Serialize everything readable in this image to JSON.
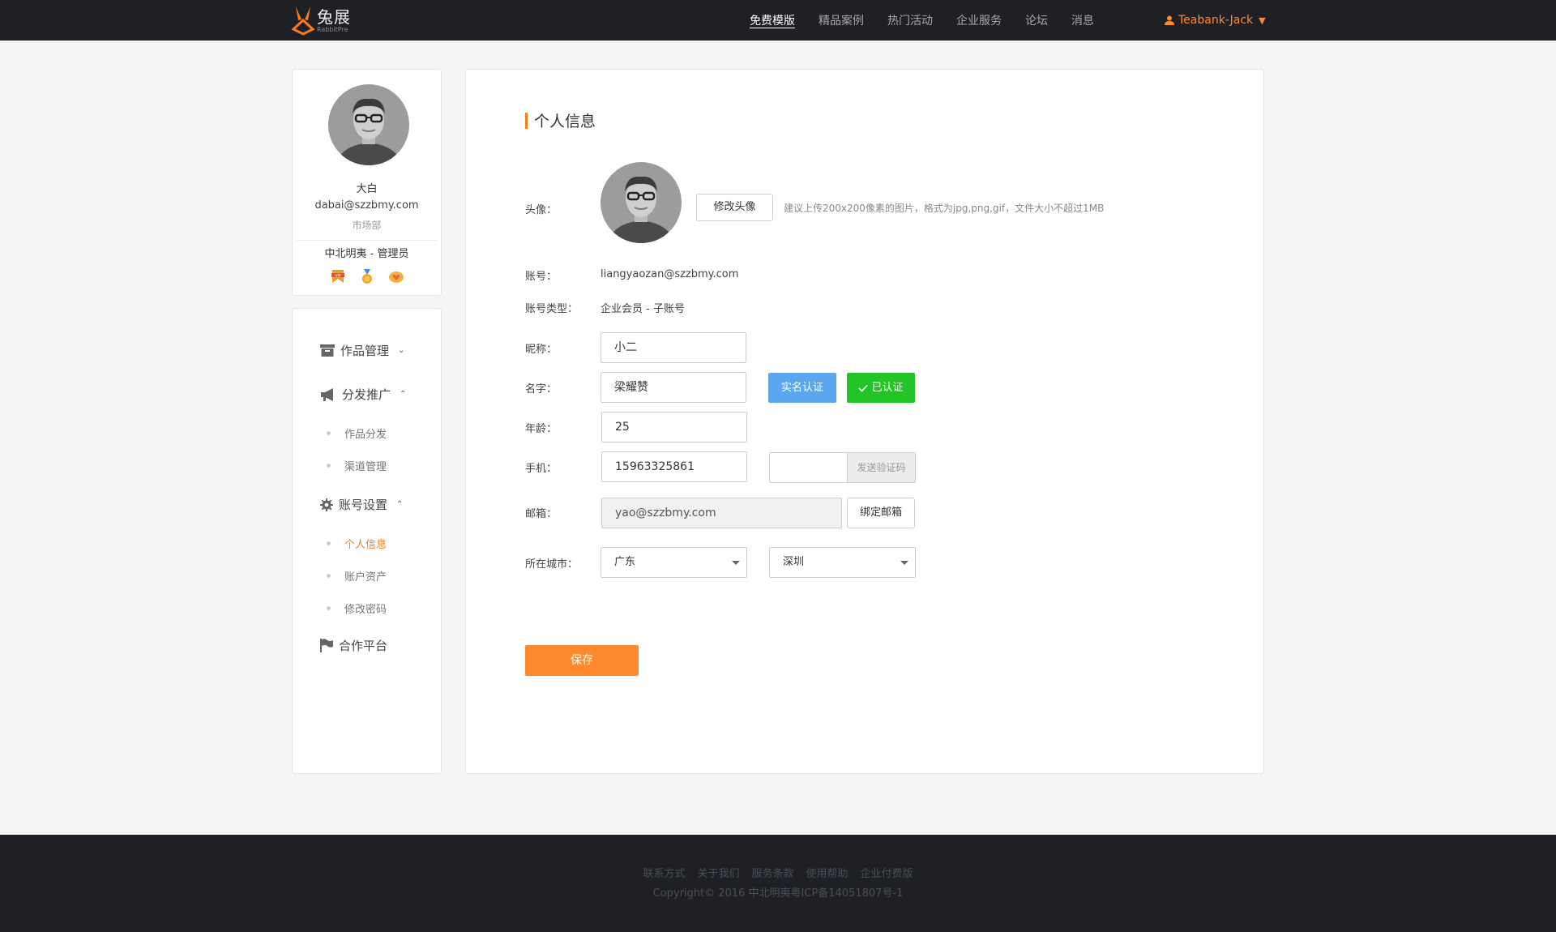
{
  "header": {
    "logo_cn": "兔展",
    "logo_en": "RabbitPre",
    "nav": [
      "免费模版",
      "精品案例",
      "热门活动",
      "企业服务",
      "论坛",
      "消息"
    ],
    "user": "Teabank-Jack"
  },
  "profile": {
    "name": "大白",
    "email": "dabai@szzbmy.com",
    "department": "市场部",
    "company": "中北明夷 - 管理员"
  },
  "menu": {
    "works": "作品管理",
    "promotion": "分发推广",
    "promotion_items": [
      "作品分发",
      "渠道管理"
    ],
    "account": "账号设置",
    "account_items": [
      "个人信息",
      "账户资产",
      "修改密码"
    ],
    "partner": "合作平台"
  },
  "form": {
    "title": "个人信息",
    "avatar_label": "头像：",
    "change_avatar": "修改头像",
    "avatar_hint": "建议上传200x200像素的图片，格式为jpg,png,gif，文件大小不超过1MB",
    "account_label": "账号：",
    "account_value": "liangyaozan@szzbmy.com",
    "type_label": "账号类型：",
    "type_value": "企业会员 - 子账号",
    "nickname_label": "昵称：",
    "nickname_value": "小二",
    "name_label": "名字：",
    "name_value": "梁耀赞",
    "realname_btn": "实名认证",
    "verified_btn": "已认证",
    "age_label": "年龄：",
    "age_value": "25",
    "phone_label": "手机：",
    "phone_value": "15963325861",
    "sms_btn": "发送验证码",
    "email_label": "邮箱：",
    "email_value": "yao@szzbmy.com",
    "bind_email_btn": "绑定邮箱",
    "city_label": "所在城市：",
    "province": "广东",
    "city": "深圳",
    "save_btn": "保存"
  },
  "footer": {
    "links": [
      "联系方式",
      "关于我们",
      "服务条款",
      "使用帮助",
      "企业付费版"
    ],
    "copyright": "Copyright© 2016 中北明夷粤ICP备14051807号-1"
  },
  "colors": {
    "accent": "#ff7a1a",
    "topbar": "#1e2026",
    "blue": "#5aa6ef",
    "green": "#23c425"
  }
}
